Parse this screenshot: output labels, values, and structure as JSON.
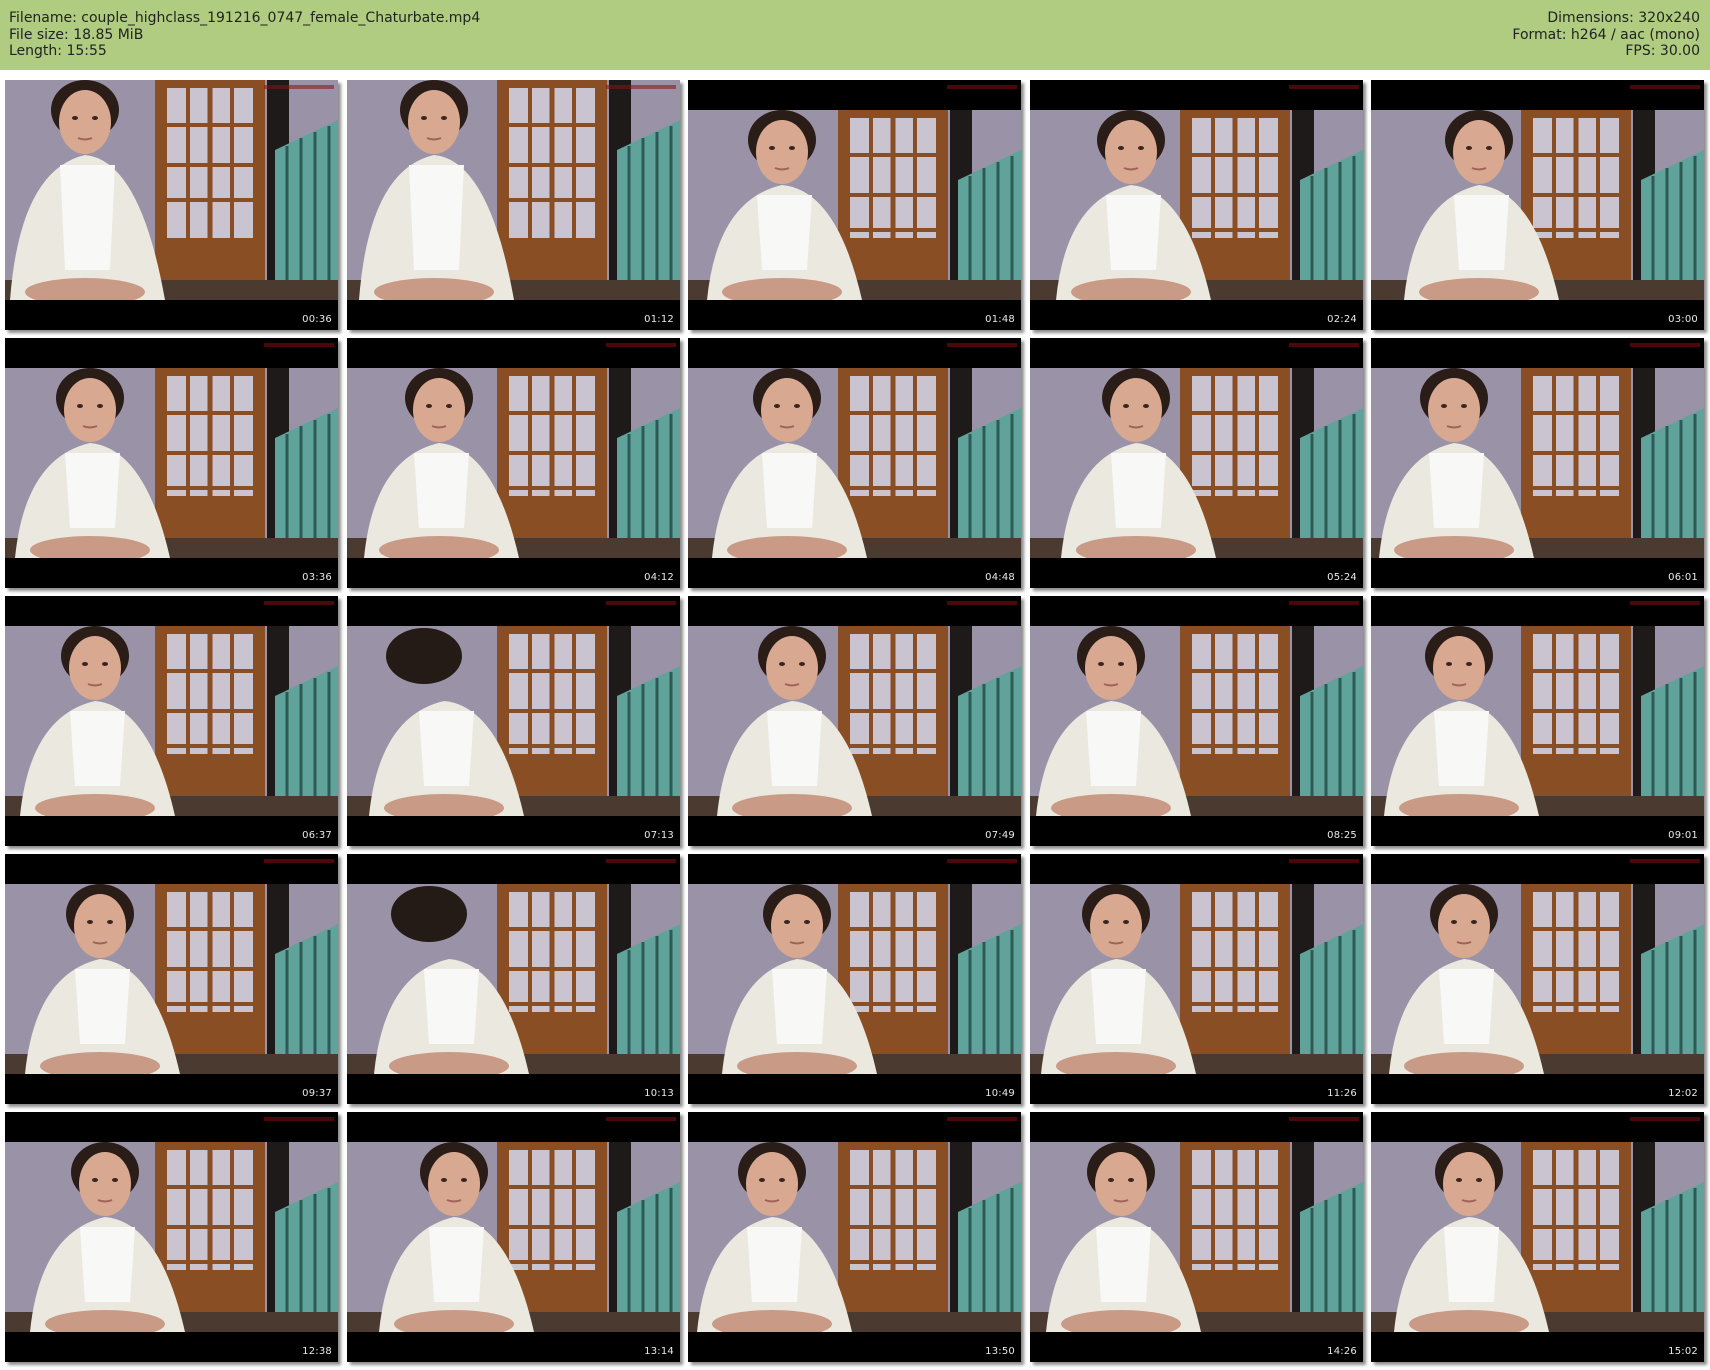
{
  "header": {
    "filename_label": "Filename: couple_highclass_191216_0747_female_Chaturbate.mp4",
    "filesize_label": "File size: 18.85 MiB",
    "length_label": "Length: 15:55",
    "dimensions_label": "Dimensions: 320x240",
    "format_label": "Format: h264 / aac (mono)",
    "fps_label": "FPS: 30.00"
  },
  "colors": {
    "header_bg": "#b0cc80",
    "thumb_bg": "#000000",
    "wall": "#9a93a8",
    "door_wood": "#8a4e24",
    "robe": "#ebe8df",
    "crib": "#5fa39a"
  },
  "thumbnails": [
    {
      "timestamp": "00:36"
    },
    {
      "timestamp": "01:12"
    },
    {
      "timestamp": "01:48"
    },
    {
      "timestamp": "02:24"
    },
    {
      "timestamp": "03:00"
    },
    {
      "timestamp": "03:36"
    },
    {
      "timestamp": "04:12"
    },
    {
      "timestamp": "04:48"
    },
    {
      "timestamp": "05:24"
    },
    {
      "timestamp": "06:01"
    },
    {
      "timestamp": "06:37"
    },
    {
      "timestamp": "07:13"
    },
    {
      "timestamp": "07:49"
    },
    {
      "timestamp": "08:25"
    },
    {
      "timestamp": "09:01"
    },
    {
      "timestamp": "09:37"
    },
    {
      "timestamp": "10:13"
    },
    {
      "timestamp": "10:49"
    },
    {
      "timestamp": "11:26"
    },
    {
      "timestamp": "12:02"
    },
    {
      "timestamp": "12:38"
    },
    {
      "timestamp": "13:14"
    },
    {
      "timestamp": "13:50"
    },
    {
      "timestamp": "14:26"
    },
    {
      "timestamp": "15:02"
    }
  ]
}
